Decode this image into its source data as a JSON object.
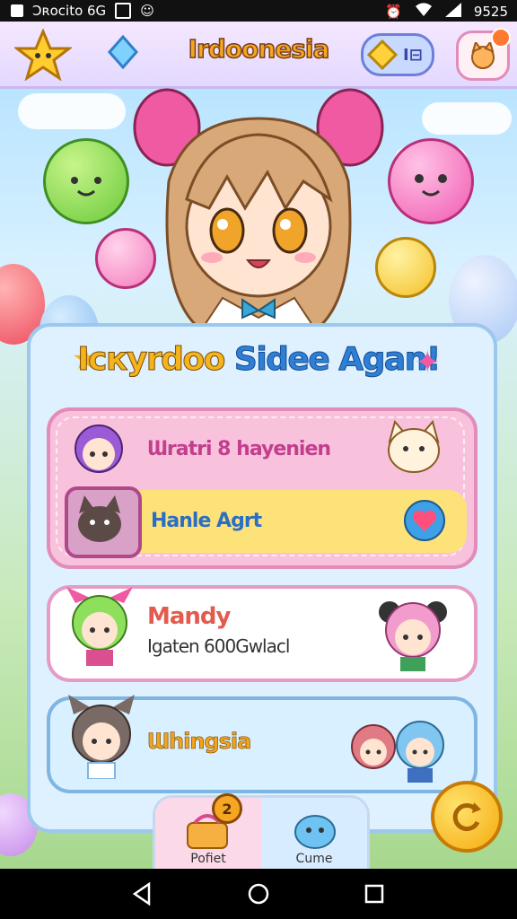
{
  "status_bar": {
    "left_text": "Ɔʀocito 6G",
    "time": "9525"
  },
  "header": {
    "title": "Irdoonesia",
    "gem_value": "I⊟"
  },
  "panel": {
    "title_left": "Icкyrdoo",
    "title_right": "Sidee Agan!"
  },
  "cards": [
    {
      "line1": "Ɯratri 8 hayenien",
      "line2": "Hanle Agrt"
    },
    {
      "line1": "Mandy",
      "line2": "Igaten 600Gwlacl"
    },
    {
      "line1": "Ɯhingsia"
    }
  ],
  "dock": {
    "tab1_label": "Pofiet",
    "tab1_badge": "2",
    "tab2_label": "Cume"
  },
  "colors": {
    "accent_title": "#f4a623",
    "panel_blue": "#2e7fd6",
    "card_pink": "#f9c2dc"
  }
}
